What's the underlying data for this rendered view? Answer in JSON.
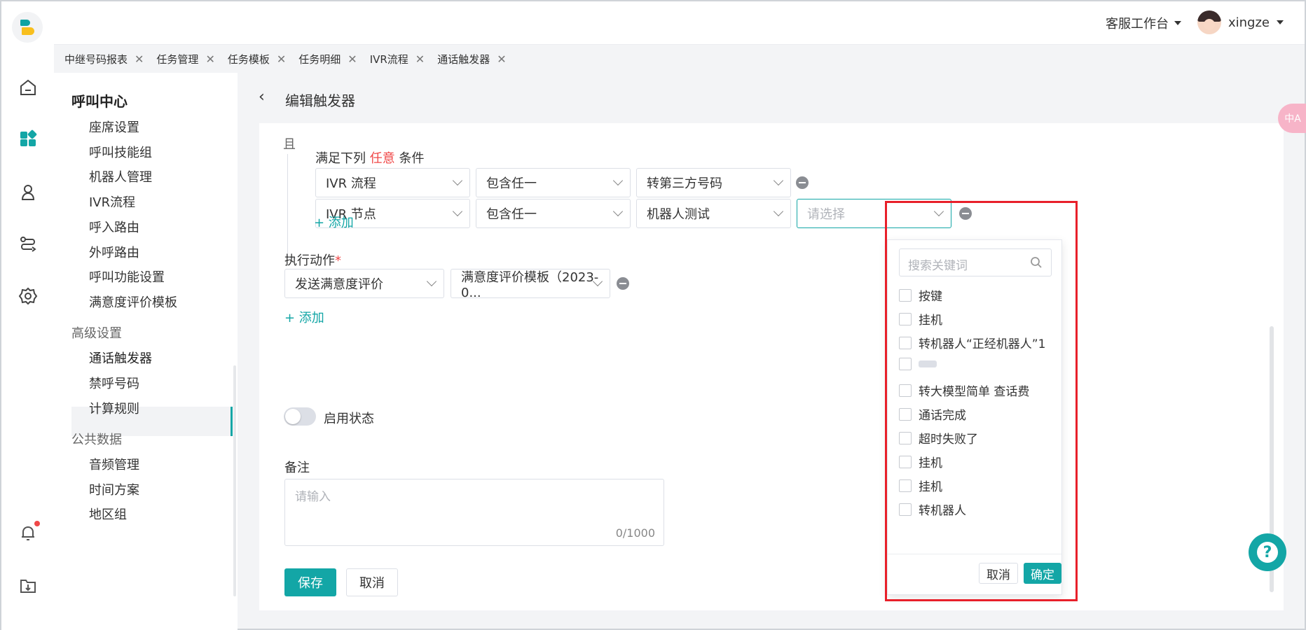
{
  "header": {
    "workspace": "客服工作台",
    "username": "xingze"
  },
  "tabs": [
    "中继号码报表",
    "任务管理",
    "任务模板",
    "任务明细",
    "IVR流程",
    "通话触发器"
  ],
  "rail_icons": [
    "home-icon",
    "apps-icon",
    "user-location-icon",
    "route-icon",
    "settings-icon",
    "bell-icon",
    "download-folder-icon"
  ],
  "sidebar": {
    "title": "呼叫中心",
    "items": [
      "座席设置",
      "呼叫技能组",
      "机器人管理",
      "IVR流程",
      "呼入路由",
      "外呼路由",
      "呼叫功能设置",
      "满意度评价模板"
    ],
    "group_advanced": "高级设置",
    "advanced_items": [
      "通话触发器",
      "禁呼号码",
      "计算规则"
    ],
    "group_public": "公共数据",
    "public_items": [
      "音频管理",
      "时间方案",
      "地区组"
    ],
    "active": "通话触发器"
  },
  "page": {
    "title": "编辑触发器",
    "and_label": "且",
    "cond_prefix": "满足下列",
    "cond_highlight": "任意",
    "cond_suffix": "条件",
    "row1": {
      "field": "IVR 流程",
      "op": "包含任一",
      "value": "转第三方号码"
    },
    "row2": {
      "field": "IVR 节点",
      "op": "包含任一",
      "value": "机器人测试",
      "placeholder": "请选择"
    },
    "add_label": "+ 添加",
    "action_label": "执行动作",
    "action_required": "*",
    "action_type": "发送满意度评价",
    "action_template": "满意度评价模板（2023-0...",
    "add_label2": "+ 添加",
    "status_label": "启用状态",
    "status_on": false,
    "note_label": "备注",
    "note_placeholder": "请输入",
    "note_count": "0/1000",
    "save": "保存",
    "cancel": "取消"
  },
  "dropdown": {
    "search_placeholder": "搜索关键词",
    "options": [
      "按键",
      "挂机",
      "转机器人“正经机器人”1",
      "",
      "转大模型简单 查话费",
      "通话完成",
      "超时失败了",
      "挂机",
      "挂机",
      "转机器人"
    ],
    "cancel": "取消",
    "confirm": "确定"
  },
  "floating": {
    "translate": "中A",
    "help": "?"
  },
  "colors": {
    "accent": "#13a6a6",
    "danger": "#f04848",
    "highlight_box": "#e8202a"
  }
}
